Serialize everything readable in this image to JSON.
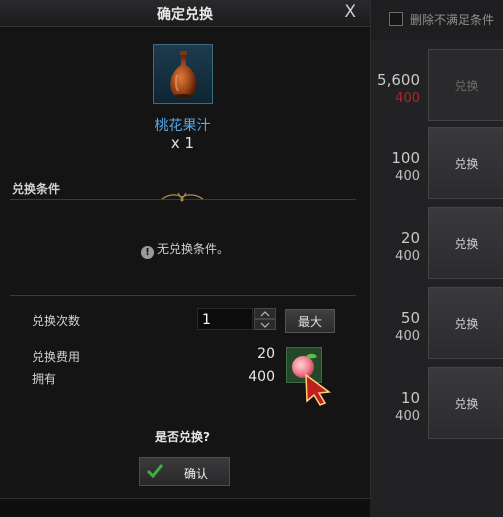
{
  "dialog": {
    "title": "确定兑换",
    "close_label": "X",
    "item": {
      "name": "桃花果汁",
      "quantity": "x 1",
      "icon": "vase-icon"
    },
    "conditions": {
      "section_title": "兑换条件",
      "message": "无兑换条件。",
      "icon_glyph": "!"
    },
    "exchange": {
      "count_label": "兑换次数",
      "count_value": "1",
      "max_label": "最大",
      "cost_label": "兑换费用",
      "cost_value": "20",
      "owned_label": "拥有",
      "owned_value": "400",
      "currency_icon": "peach-token-icon"
    },
    "confirm_question": "是否兑换?",
    "confirm_label": "确认"
  },
  "shop_list": {
    "filter_label": "删除不满足条件",
    "rows": [
      {
        "price": "5,600",
        "stock": "400",
        "stock_insufficient": true,
        "button": "兑换",
        "enabled": false
      },
      {
        "price": "100",
        "stock": "400",
        "stock_insufficient": false,
        "button": "兑换",
        "enabled": true
      },
      {
        "price": "20",
        "stock": "400",
        "stock_insufficient": false,
        "button": "兑换",
        "enabled": true
      },
      {
        "price": "50",
        "stock": "400",
        "stock_insufficient": false,
        "button": "兑换",
        "enabled": true
      },
      {
        "price": "10",
        "stock": "400",
        "stock_insufficient": false,
        "button": "兑换",
        "enabled": true
      }
    ]
  },
  "colors": {
    "item_name": "#5aa8e6",
    "insufficient": "#a52a2a",
    "confirm_check": "#3fae3f"
  }
}
